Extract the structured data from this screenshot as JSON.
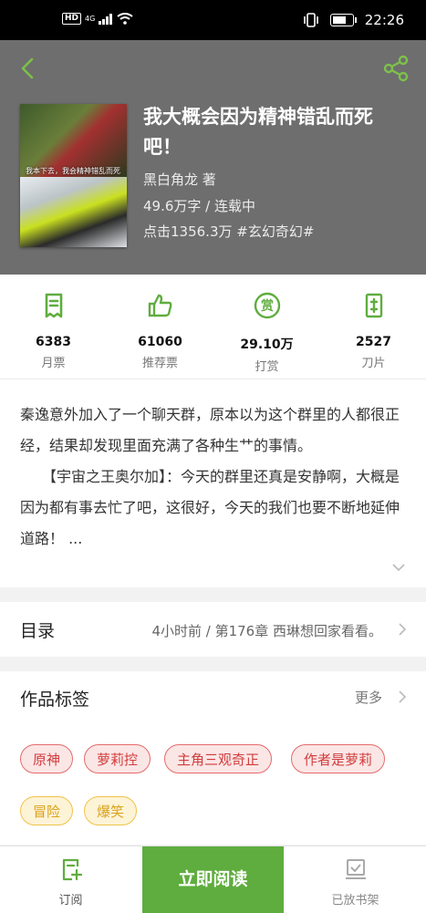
{
  "status_bar": {
    "time": "22:26",
    "network": "4G",
    "hd": "HD",
    "battery_level": 0.8
  },
  "header": {
    "book_title": "我大概会因为精神错乱而死吧！",
    "author": "黑白角龙  著",
    "word_status": "49.6万字 / 连载中",
    "clicks_genre": "点击1356.3万  #玄幻奇幻#",
    "cover_caption": "我本下去，我会精神错乱而死"
  },
  "stats": [
    {
      "icon": "monthly-ticket-icon",
      "value": "6383",
      "label": "月票"
    },
    {
      "icon": "thumbs-up-icon",
      "value": "61060",
      "label": "推荐票"
    },
    {
      "icon": "reward-icon",
      "value": "29.10万",
      "label": "打赏"
    },
    {
      "icon": "blade-icon",
      "value": "2527",
      "label": "刀片"
    }
  ],
  "intro": {
    "text": "秦逸意外加入了一个聊天群，原本以为这个群里的人都很正经，结果却发现里面充满了各种生艹的事情。\n　　【宇宙之王奥尔加】：今天的群里还真是安静啊，大概是因为都有事去忙了吧，这很好，今天的我们也要不断地延伸道路！ ..."
  },
  "catalog": {
    "title": "目录",
    "latest": "4小时前 / 第176章 西琳想回家看看。"
  },
  "tags": {
    "title": "作品标签",
    "more": "更多",
    "items": [
      {
        "label": "原神",
        "style": "red"
      },
      {
        "label": "萝莉控",
        "style": "red"
      },
      {
        "label": "主角三观奇正",
        "style": "red"
      },
      {
        "label": "作者是萝莉",
        "style": "red"
      },
      {
        "label": "冒险",
        "style": "yellow"
      },
      {
        "label": "爆笑",
        "style": "yellow"
      }
    ]
  },
  "bottom_bar": {
    "subscribe": "订阅",
    "read_now": "立即阅读",
    "shelved": "已放书架"
  },
  "colors": {
    "accent": "#5fad3e",
    "header_bg": "#6e6e6e",
    "tag_red": "#d23c3c",
    "tag_yellow": "#d9a21b"
  }
}
